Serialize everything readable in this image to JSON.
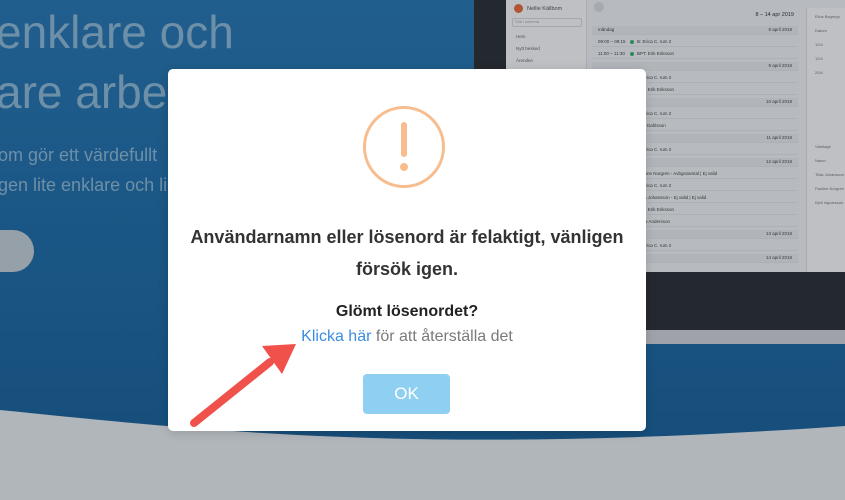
{
  "background": {
    "hero_title_line1": "enklare och",
    "hero_title_line2": "are arbe",
    "hero_sub_line1": "om gör ett värdefullt",
    "hero_sub_line2": "gen lite enklare och li"
  },
  "laptop": {
    "user_name": "Nellie Källbom",
    "search_placeholder": "Sök i schema",
    "nav": [
      "Hem",
      "Nytt besked",
      "Ärenden"
    ],
    "date_range": "8 – 14 apr 2019",
    "calendar_rows": [
      {
        "kind": "day",
        "label": "måndag",
        "date": "8 april 2019"
      },
      {
        "kind": "event",
        "time": "09:00 – 09:15",
        "name": "B: Erica C. rum 2"
      },
      {
        "kind": "event",
        "time": "11:00 – 11:30",
        "name": "BPT: Erik Eriksson"
      },
      {
        "kind": "day",
        "label": "",
        "date": "9 april 2019"
      },
      {
        "kind": "event",
        "time": "",
        "name": "B: Erica C. rum 2"
      },
      {
        "kind": "event",
        "time": "",
        "name": "BPT: Erik Eriksson"
      },
      {
        "kind": "day",
        "label": "",
        "date": "10 april 2019"
      },
      {
        "kind": "event",
        "time": "",
        "name": "B: Erica C. rum 2"
      },
      {
        "kind": "event",
        "time": "",
        "name": "Emil Dahlsson"
      },
      {
        "kind": "day",
        "label": "",
        "date": "11 april 2019"
      },
      {
        "kind": "event",
        "time": "",
        "name": "B: Erica C. rum 2"
      },
      {
        "kind": "day",
        "label": "",
        "date": "12 april 2019"
      },
      {
        "kind": "event",
        "time": "",
        "name": "Pauline Norgren - Avbgssamtal | Ej valid"
      },
      {
        "kind": "event",
        "time": "",
        "name": "B: Erica C. rum 2"
      },
      {
        "kind": "event",
        "time": "",
        "name": "Tilda Johansson - Ej valid | Ej valid"
      },
      {
        "kind": "event",
        "time": "",
        "name": "BPT: Erik Eriksson"
      },
      {
        "kind": "event",
        "time": "",
        "name": "Anna Andersson"
      },
      {
        "kind": "day",
        "label": "",
        "date": "13 april 2019"
      },
      {
        "kind": "event",
        "time": "",
        "name": "B: Erica C. rum 2"
      },
      {
        "kind": "day",
        "label": "",
        "date": "14 april 2019"
      }
    ],
    "right_panel": [
      "Eilos Begrepp",
      "Datum",
      "12/4",
      "12/4",
      "20/4",
      "Väntlage",
      "Namn",
      "Tilda Johansson",
      "Pauline Norgren",
      "Kjell Ingvarsson"
    ]
  },
  "modal": {
    "message": "Användarnamn eller lösenord är felaktigt, vänligen försök igen.",
    "forgot_title": "Glömt lösenordet?",
    "reset_link": "Klicka här",
    "reset_rest": " för att återställa det",
    "ok_label": "OK",
    "icon_color": "#f7bd8f",
    "ok_color": "#8fd0f2",
    "link_color": "#3a8ee0"
  },
  "annotation": {
    "arrow_color": "#f0514a"
  }
}
